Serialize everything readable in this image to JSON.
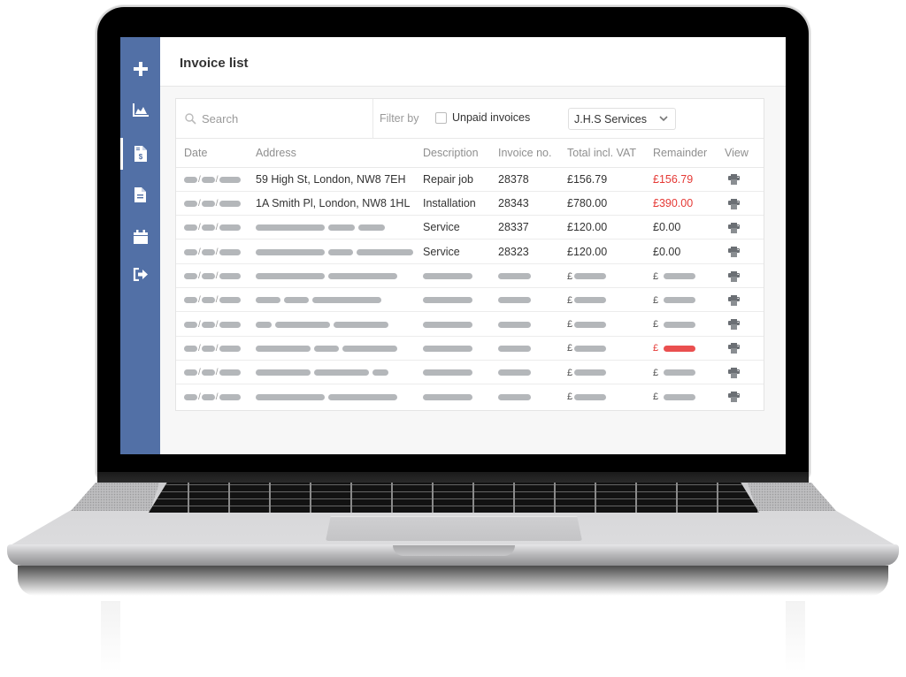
{
  "app": {
    "title": "Invoice list",
    "sidebar": {
      "items": [
        {
          "name": "add",
          "icon": "plus-icon",
          "active": false
        },
        {
          "name": "reports",
          "icon": "area-chart-icon",
          "active": false
        },
        {
          "name": "invoices",
          "icon": "invoice-dollar-icon",
          "active": true
        },
        {
          "name": "documents",
          "icon": "document-icon",
          "active": false
        },
        {
          "name": "calendar",
          "icon": "calendar-icon",
          "active": false
        },
        {
          "name": "logout",
          "icon": "sign-out-icon",
          "active": false
        }
      ]
    },
    "toolbar": {
      "search_placeholder": "Search",
      "search_value": "",
      "filter_label": "Filter by",
      "unpaid_label": "Unpaid invoices",
      "unpaid_checked": false,
      "client_select": "J.H.S Services"
    },
    "table": {
      "columns": [
        "Date",
        "Address",
        "Description",
        "Invoice no.",
        "Total incl. VAT",
        "Remainder",
        "View"
      ],
      "rows": [
        {
          "date": "",
          "address": "59 High St, London, NW8 7EH",
          "description": "Repair job",
          "invoice_no": "28378",
          "total": "£156.79",
          "remainder": "£156.79",
          "remainder_overdue": true
        },
        {
          "date": "",
          "address": "1A Smith Pl, London, NW8 1HL",
          "description": "Installation",
          "invoice_no": "28343",
          "total": "£780.00",
          "remainder": "£390.00",
          "remainder_overdue": true
        },
        {
          "date": "",
          "address": "",
          "description": "Service",
          "invoice_no": "28337",
          "total": "£120.00",
          "remainder": "£0.00",
          "remainder_overdue": false
        },
        {
          "date": "",
          "address": "",
          "description": "Service",
          "invoice_no": "28323",
          "total": "£120.00",
          "remainder": "£0.00",
          "remainder_overdue": false
        },
        {
          "placeholder": true,
          "remainder_overdue": false
        },
        {
          "placeholder": true,
          "remainder_overdue": false
        },
        {
          "placeholder": true,
          "remainder_overdue": false
        },
        {
          "placeholder": true,
          "remainder_overdue": true
        },
        {
          "placeholder": true,
          "remainder_overdue": false
        },
        {
          "placeholder": true,
          "remainder_overdue": false
        }
      ],
      "currency_symbol": "£",
      "date_separator": "/",
      "view_icon": "printer-icon"
    },
    "colors": {
      "sidebar": "#5270a6",
      "overdue": "#e53935",
      "placeholder_bar": "#b4b7ba"
    }
  }
}
